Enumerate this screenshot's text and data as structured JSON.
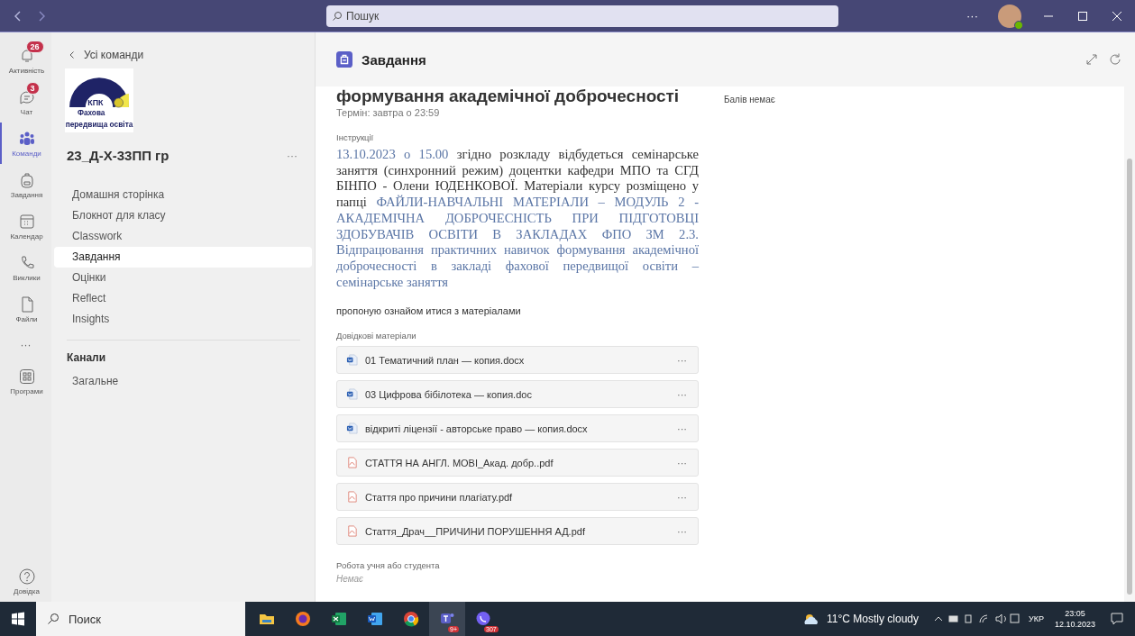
{
  "titlebar": {
    "search_placeholder": "Пошук",
    "more": "···"
  },
  "rail": {
    "items": [
      {
        "kind": "bell",
        "label": "Активність",
        "badge": "26",
        "selected": false
      },
      {
        "kind": "chat",
        "label": "Чат",
        "badge": "3",
        "selected": false
      },
      {
        "kind": "teams",
        "label": "Команди",
        "selected": true
      },
      {
        "kind": "backpack",
        "label": "Завдання",
        "selected": false
      },
      {
        "kind": "calendar",
        "label": "Календар",
        "selected": false
      },
      {
        "kind": "phone",
        "label": "Виклики",
        "selected": false
      },
      {
        "kind": "file",
        "label": "Файли",
        "selected": false
      }
    ],
    "more": "···",
    "apps": {
      "label": "Програми"
    },
    "help": {
      "label": "Довідка"
    }
  },
  "team_panel": {
    "back_link": "Усі команди",
    "logo": {
      "line_1": "КПК",
      "line_2": "Фахова",
      "line_3": "передвища освіта"
    },
    "team_name": "23_Д-Х-33ПП гр",
    "more": "···",
    "nav": [
      {
        "label": "Домашня сторінка",
        "selected": false
      },
      {
        "label": "Блокнот для класу",
        "selected": false
      },
      {
        "label": "Classwork",
        "selected": false
      },
      {
        "label": "Завдання",
        "selected": true
      },
      {
        "label": "Оцінки",
        "selected": false
      },
      {
        "label": "Reflect",
        "selected": false
      },
      {
        "label": "Insights",
        "selected": false
      }
    ],
    "channels_heading": "Канали",
    "channels": [
      {
        "label": "Загальне",
        "selected": false
      }
    ]
  },
  "main": {
    "header_title": "Завдання",
    "assignment": {
      "title": "формування академічної доброчесності",
      "due": "Термін: завтра о 23:59",
      "points": "Балів немає",
      "instructions_label": "Інструкції",
      "instructions": [
        {
          "kind": "highlight",
          "text": "13.10.2023 о 15.00"
        },
        {
          "kind": "plain",
          "text": " згідно розкладу відбудеться семінарське заняття (синхронний режим) доцентки кафедри МПО та СГД БІНПО - Олени ЮДЕНКОВОЇ. Матеріали курсу розміщено у папці "
        },
        {
          "kind": "highlight",
          "text": "ФАЙЛИ-НАВЧАЛЬНІ МАТЕРІАЛИ – МОДУЛЬ 2 - АКАДЕМІЧНА ДОБРОЧЕСНІСТЬ ПРИ ПІДГОТОВЦІ ЗДОБУВАЧІВ ОСВІТИ В ЗАКЛАДАХ ФПО ЗМ 2.3. Відпрацювання практичних навичок формування академічної доброчесності в закладі фахової передвищої освіти – семінарське заняття"
        }
      ],
      "note": "пропоную ознайом итися з матеріалами",
      "references_label": "Довідкові матеріали",
      "files": [
        {
          "kind": "word",
          "name": "01 Тематичний план — копия.docx",
          "more": "···"
        },
        {
          "kind": "word",
          "name": "03 Цифрова бібілотека — копия.doc",
          "more": "···"
        },
        {
          "kind": "word",
          "name": "відкриті ліцензії - авторське право — копия.docx",
          "more": "···"
        },
        {
          "kind": "pdf",
          "name": "СТАТТЯ НА АНГЛ. МОВІ_Акад. добр..pdf",
          "more": "···"
        },
        {
          "kind": "pdf",
          "name": "Стаття про причини плагіату.pdf",
          "more": "···"
        },
        {
          "kind": "pdf",
          "name": "Стаття_Драч__ПРИЧИНИ ПОРУШЕННЯ АД.pdf",
          "more": "···"
        }
      ],
      "student_work_label": "Робота учня або студента",
      "student_work_value": "Немає"
    }
  },
  "taskbar": {
    "search_placeholder": "Поиск",
    "apps": [
      {
        "kind": "folder",
        "active": false
      },
      {
        "kind": "firefox",
        "active": false
      },
      {
        "kind": "excel",
        "active": false
      },
      {
        "kind": "word",
        "active": false
      },
      {
        "kind": "chrome",
        "active": false
      },
      {
        "kind": "teams",
        "badge": "9+",
        "active": true
      },
      {
        "kind": "viber",
        "badge": "307",
        "active": false
      }
    ],
    "weather": "11°C Mostly cloudy",
    "language": "УКР",
    "time": "23:05",
    "date": "12.10.2023"
  }
}
